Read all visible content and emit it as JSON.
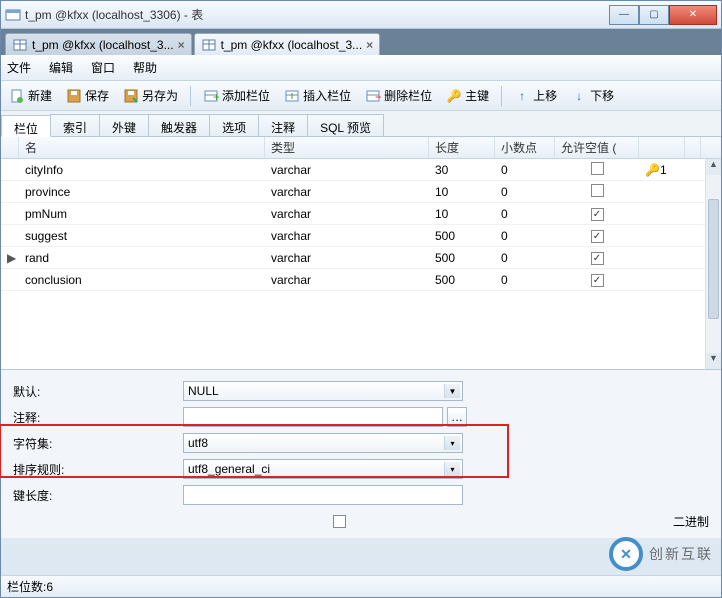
{
  "window": {
    "title": "t_pm @kfxx (localhost_3306) - 表"
  },
  "doctabs": [
    {
      "icon": "table-icon",
      "label": "t_pm @kfxx (localhost_3...",
      "active": false
    },
    {
      "icon": "table-icon",
      "label": "t_pm @kfxx (localhost_3...",
      "active": true
    }
  ],
  "menu": {
    "file": "文件",
    "edit": "编辑",
    "window": "窗口",
    "help": "帮助"
  },
  "toolbar": {
    "new": "新建",
    "save": "保存",
    "saveas": "另存为",
    "addfield": "添加栏位",
    "insertfield": "插入栏位",
    "deletefield": "删除栏位",
    "primarykey": "主键",
    "moveup": "上移",
    "movedown": "下移"
  },
  "subtabs": {
    "fields": "栏位",
    "indexes": "索引",
    "fk": "外键",
    "triggers": "触发器",
    "options": "选项",
    "comment": "注释",
    "sqlpreview": "SQL 预览"
  },
  "grid": {
    "headers": {
      "name": "名",
      "type": "类型",
      "length": "长度",
      "decimals": "小数点",
      "allownull": "允许空值 ("
    },
    "rows": [
      {
        "name": "cityInfo",
        "type": "varchar",
        "length": "30",
        "decimals": "0",
        "allownull": false,
        "pk": "1",
        "marker": ""
      },
      {
        "name": "province",
        "type": "varchar",
        "length": "10",
        "decimals": "0",
        "allownull": false,
        "pk": "",
        "marker": ""
      },
      {
        "name": "pmNum",
        "type": "varchar",
        "length": "10",
        "decimals": "0",
        "allownull": true,
        "pk": "",
        "marker": ""
      },
      {
        "name": "suggest",
        "type": "varchar",
        "length": "500",
        "decimals": "0",
        "allownull": true,
        "pk": "",
        "marker": ""
      },
      {
        "name": "rand",
        "type": "varchar",
        "length": "500",
        "decimals": "0",
        "allownull": true,
        "pk": "",
        "marker": "▶"
      },
      {
        "name": "conclusion",
        "type": "varchar",
        "length": "500",
        "decimals": "0",
        "allownull": true,
        "pk": "",
        "marker": ""
      }
    ]
  },
  "form": {
    "default_label": "默认:",
    "default_value": "NULL",
    "comment_label": "注释:",
    "comment_value": "",
    "charset_label": "字符集:",
    "charset_value": "utf8",
    "collation_label": "排序规则:",
    "collation_value": "utf8_general_ci",
    "keylen_label": "键长度:",
    "keylen_value": "",
    "binary_label": "二进制"
  },
  "statusbar": {
    "fieldcount_label": "栏位数: ",
    "fieldcount_value": "6"
  },
  "watermark": {
    "brand": "创新互联"
  }
}
